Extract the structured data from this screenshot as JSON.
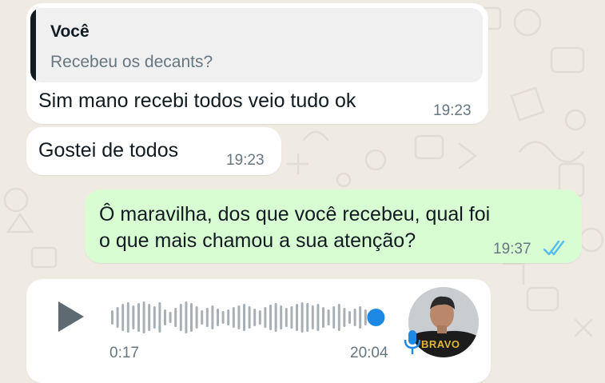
{
  "messages": {
    "m1": {
      "quote_author": "Você",
      "quote_text": "Recebeu os decants?",
      "text": "Sim mano recebi todos veio tudo ok",
      "time": "19:23"
    },
    "m2": {
      "text": "Gostei de todos",
      "time": "19:23"
    },
    "m3": {
      "line1": "Ô maravilha, dos que você recebeu, qual foi",
      "line2": "o que mais chamou a sua atenção?",
      "time": "19:37",
      "status": "read"
    },
    "voice": {
      "duration": "0:17",
      "time": "20:04",
      "progress": 1.0,
      "avatar_text": "BRAVO"
    }
  },
  "colors": {
    "wallpaper": "#efeae2",
    "incoming": "#ffffff",
    "outgoing": "#d9fdd3",
    "read_ticks": "#53bdeb",
    "accent_blue": "#1e88e5"
  },
  "icons": [
    "play-icon",
    "double-check-icon",
    "microphone-icon",
    "voice-waveform"
  ]
}
